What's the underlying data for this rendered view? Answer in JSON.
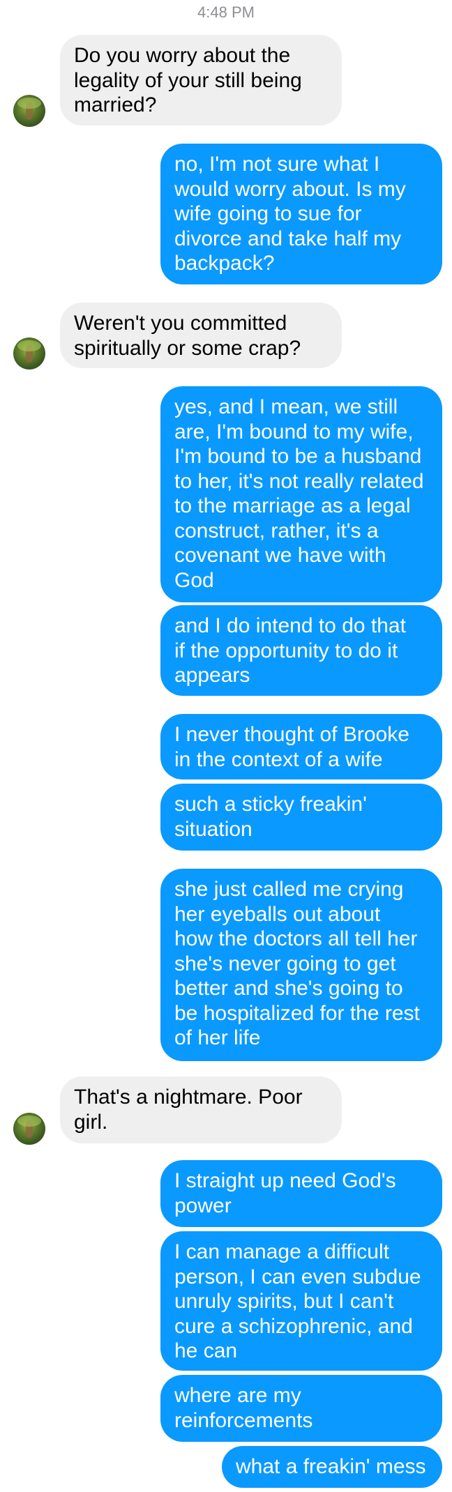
{
  "conversation": {
    "timestamp": "4:48 PM",
    "messages": [
      {
        "direction": "incoming",
        "text": "Do you worry about the\nlegality of your still being\nmarried?"
      },
      {
        "direction": "outgoing",
        "text": "no, I'm not sure what I\nwould worry about. Is my\nwife going to sue for\ndivorce and take half my\nbackpack?"
      },
      {
        "direction": "incoming",
        "text": "Weren't you committed\nspiritually or some crap?"
      },
      {
        "direction": "outgoing",
        "text": "yes, and I mean, we still\nare, I'm bound to my wife,\nI'm bound to be a husband\nto her, it's not really related\nto the marriage as a legal\nconstruct, rather, it's a\ncovenant we have with\nGod"
      },
      {
        "direction": "outgoing",
        "text": "and I do intend to do that\nif the opportunity to do it\nappears"
      },
      {
        "direction": "outgoing",
        "text": "I never thought of Brooke\nin the context of a wife"
      },
      {
        "direction": "outgoing",
        "text": "such a sticky freakin'\nsituation"
      },
      {
        "direction": "outgoing",
        "text": "she just called me crying\nher eyeballs out about\nhow the doctors all tell her\nshe's never going to get\nbetter and she's going to\nbe hospitalized for the rest\nof her life"
      },
      {
        "direction": "incoming",
        "text": "That's a nightmare. Poor\ngirl."
      },
      {
        "direction": "outgoing",
        "text": "I straight up need God's\npower"
      },
      {
        "direction": "outgoing",
        "text": "I can manage a difficult\nperson, I can even subdue\nunruly spirits, but I can't\ncure a schizophrenic, and\nhe can"
      },
      {
        "direction": "outgoing",
        "text": "where are my\nreinforcements"
      },
      {
        "direction": "outgoing",
        "text": "what a freakin' mess"
      }
    ]
  },
  "colors": {
    "outgoing_bubble": "#0a99ff",
    "incoming_bubble": "#efefef",
    "timestamp": "#8e8e93"
  },
  "icons": {
    "contact_avatar": "contact-avatar-photo"
  }
}
